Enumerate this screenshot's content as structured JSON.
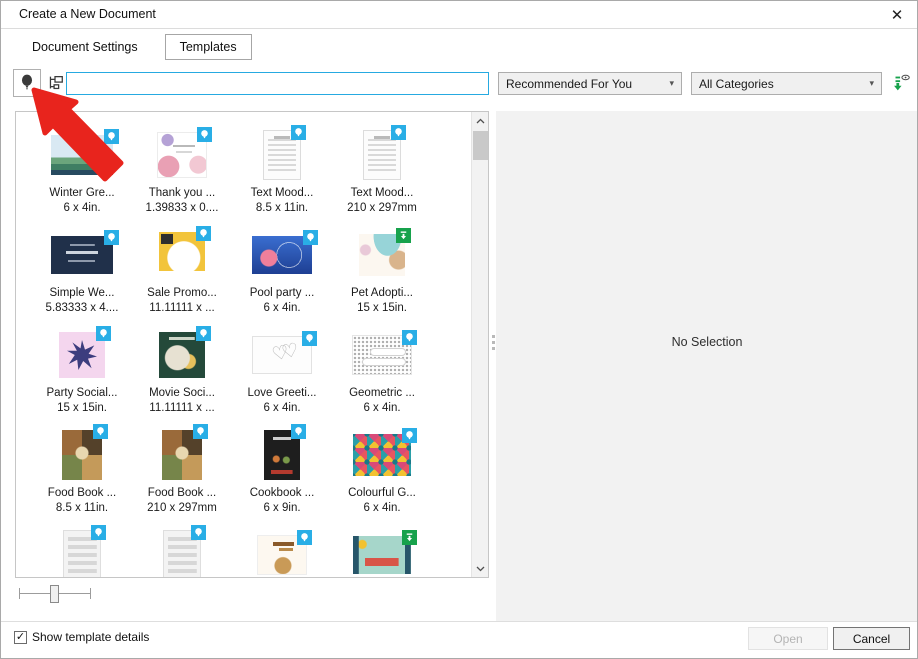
{
  "dialog": {
    "title": "Create a New Document",
    "close_glyph": "✕"
  },
  "tabs": [
    {
      "label": "Document Settings",
      "active": false
    },
    {
      "label": "Templates",
      "active": true
    }
  ],
  "toolbar": {
    "search_value": "",
    "search_placeholder": "",
    "category_primary": "Recommended For You",
    "category_secondary": "All Categories",
    "dropdown_arrow_glyph": "▼",
    "icons": [
      "filter-balloon-icon",
      "tree-view-icon",
      "online-content-toggle-icon"
    ]
  },
  "templates": [
    {
      "name": "Winter Gre...",
      "size": "6 x 4in.",
      "badge": "online",
      "thumb": "winter"
    },
    {
      "name": "Thank you ...",
      "size": "1.39833 x 0....",
      "badge": "online",
      "thumb": "thankyou"
    },
    {
      "name": "Text Mood...",
      "size": "8.5 x 11in.",
      "badge": "online",
      "thumb": "textmood"
    },
    {
      "name": "Text Mood...",
      "size": "210 x 297mm",
      "badge": "online",
      "thumb": "textmood"
    },
    {
      "name": "Simple We...",
      "size": "5.83333 x 4....",
      "badge": "online",
      "thumb": "simplewe"
    },
    {
      "name": "Sale Promo...",
      "size": "11.11111 x ...",
      "badge": "online",
      "thumb": "salepromo"
    },
    {
      "name": "Pool party ...",
      "size": "6 x 4in.",
      "badge": "online",
      "thumb": "poolparty"
    },
    {
      "name": "Pet Adopti...",
      "size": "15 x 15in.",
      "badge": "download",
      "thumb": "petadopt"
    },
    {
      "name": "Party Social...",
      "size": "15 x 15in.",
      "badge": "online",
      "thumb": "partysocial"
    },
    {
      "name": "Movie Soci...",
      "size": "11.11111 x ...",
      "badge": "online",
      "thumb": "moviesocial"
    },
    {
      "name": "Love Greeti...",
      "size": "6 x 4in.",
      "badge": "online",
      "thumb": "lovegreeting"
    },
    {
      "name": "Geometric ...",
      "size": "6 x 4in.",
      "badge": "online",
      "thumb": "geometric"
    },
    {
      "name": "Food Book ...",
      "size": "8.5 x 11in.",
      "badge": "online",
      "thumb": "foodbook"
    },
    {
      "name": "Food Book ...",
      "size": "210 x 297mm",
      "badge": "online",
      "thumb": "foodbook"
    },
    {
      "name": "Cookbook ...",
      "size": "6 x 9in.",
      "badge": "online",
      "thumb": "cookbook"
    },
    {
      "name": "Colourful G...",
      "size": "6 x 4in.",
      "badge": "online",
      "thumb": "colourful"
    },
    {
      "name": "",
      "size": "",
      "badge": "online",
      "thumb": "docgray"
    },
    {
      "name": "",
      "size": "",
      "badge": "online",
      "thumb": "docgray"
    },
    {
      "name": "",
      "size": "",
      "badge": "online",
      "thumb": "coffee"
    },
    {
      "name": "",
      "size": "",
      "badge": "download",
      "thumb": "banner"
    }
  ],
  "preview": {
    "empty_text": "No Selection"
  },
  "footer": {
    "checkbox_label": "Show template details",
    "checkbox_checked": true,
    "check_glyph": "✓",
    "open_label": "Open",
    "open_enabled": false,
    "cancel_label": "Cancel"
  },
  "colors": {
    "search_border": "#26aae1",
    "badge_online_blue": "#29aee6",
    "badge_download_green": "#17a24c",
    "annotation_arrow_red": "#e8241d",
    "preview_panel_gray": "#f2f2f2"
  }
}
